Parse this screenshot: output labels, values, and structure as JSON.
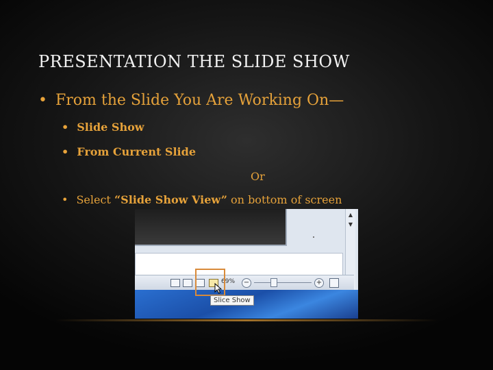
{
  "slide": {
    "title": "PRESENTATION THE SLIDE SHOW",
    "bullets": {
      "main": "From the Slide You Are Working On—",
      "sub1": "Slide Show",
      "sub2": "From Current Slide",
      "or": "Or",
      "sub3_prefix": "Select ",
      "sub3_bold": "“Slide Show View”",
      "sub3_suffix": " on bottom of screen"
    },
    "bullet_glyph": "•"
  },
  "screenshot": {
    "zoom_label": "69%",
    "tooltip": "Slice Show",
    "icons": [
      "normal-view-icon",
      "slide-sorter-icon",
      "reading-view-icon",
      "slide-show-icon",
      "zoom-out-icon",
      "zoom-in-icon",
      "fit-window-icon"
    ]
  },
  "colors": {
    "accent": "#e6a23a",
    "highlight_box": "#d88a3a"
  }
}
